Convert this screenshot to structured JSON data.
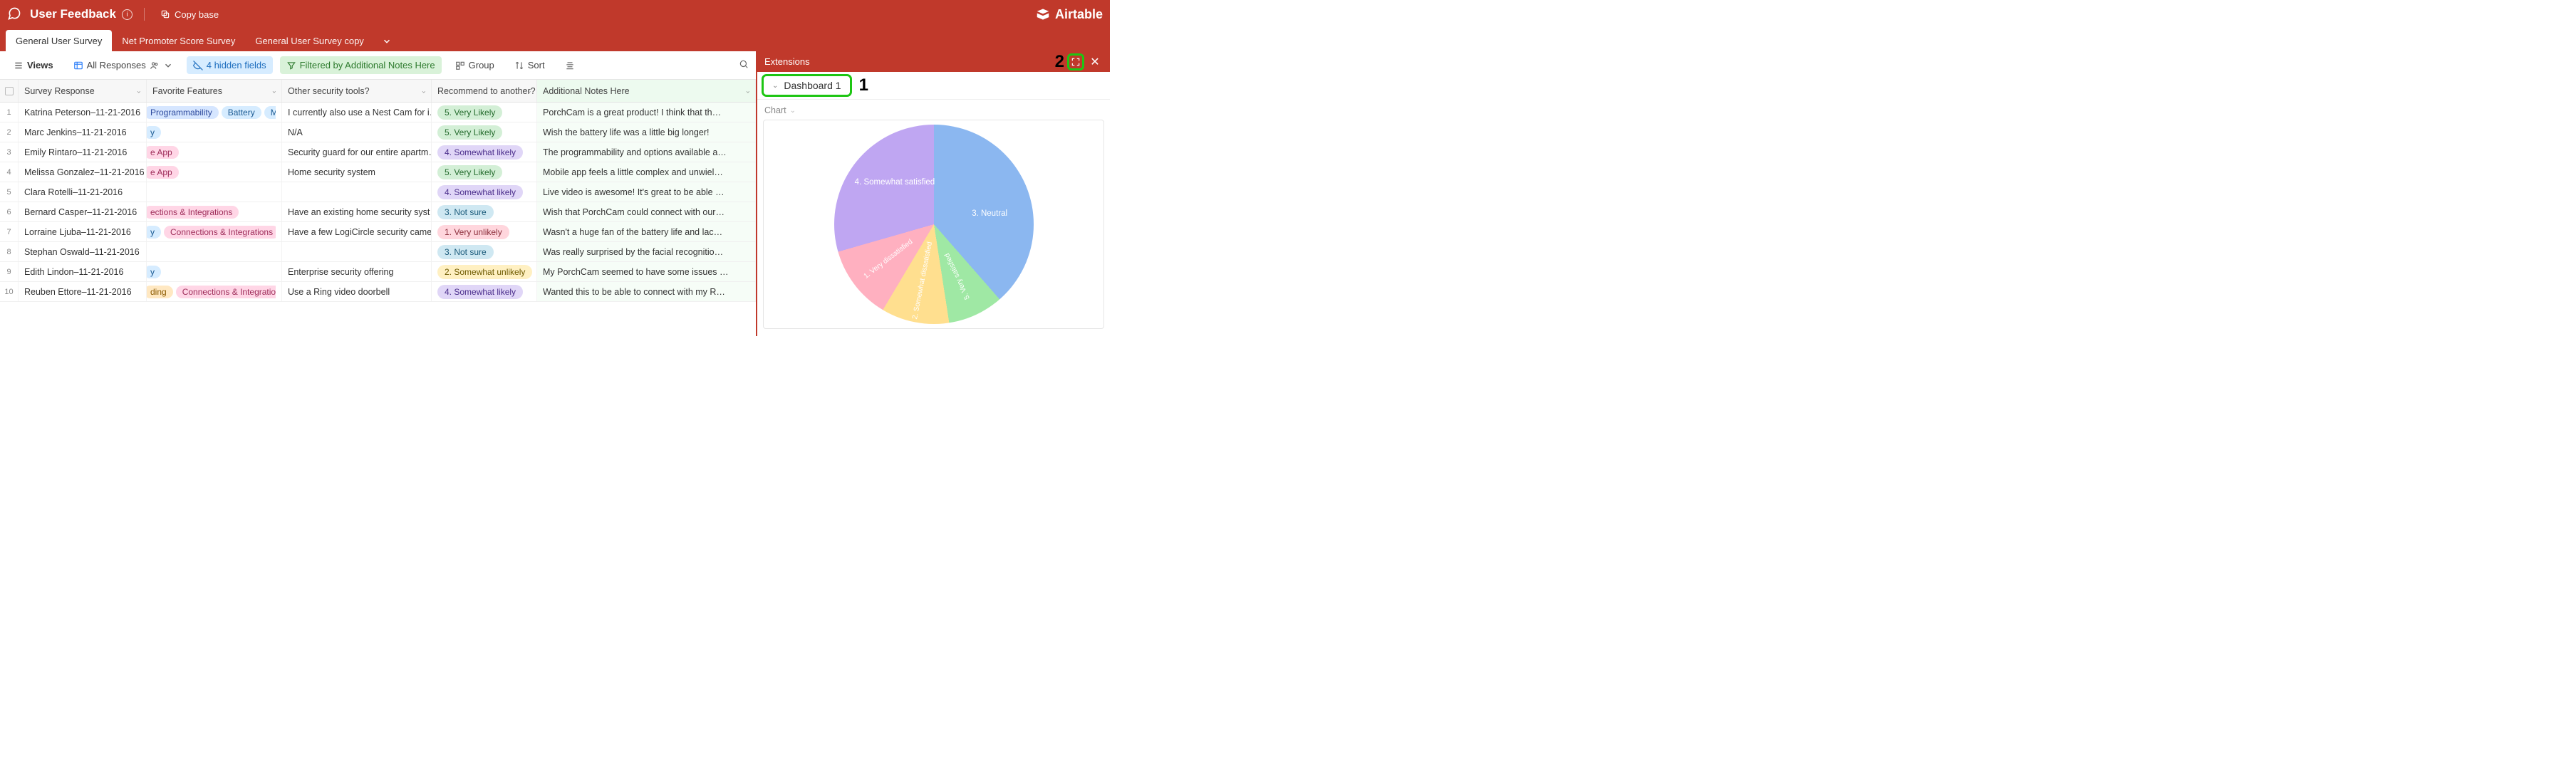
{
  "header": {
    "base_name": "User Feedback",
    "copy_label": "Copy base",
    "brand": "Airtable"
  },
  "tabs": [
    {
      "label": "General User Survey",
      "active": true
    },
    {
      "label": "Net Promoter Score Survey",
      "active": false
    },
    {
      "label": "General User Survey copy",
      "active": false
    }
  ],
  "ext_tab_label": "Extensions",
  "toolbar": {
    "views_label": "Views",
    "view_name": "All Responses",
    "hidden_fields": "4 hidden fields",
    "filter_label": "Filtered by Additional Notes Here",
    "group_label": "Group",
    "sort_label": "Sort"
  },
  "columns": {
    "survey_response": "Survey Response",
    "favorite_features": "Favorite Features",
    "other_security": "Other security tools?",
    "recommend": "Recommend to another?",
    "additional_notes": "Additional Notes Here"
  },
  "likert": {
    "r1": "1. Very unlikely",
    "r2": "2. Somewhat unlikely",
    "r3": "3. Not sure",
    "r4": "4. Somewhat likely",
    "r5": "5. Very Likely"
  },
  "feature_tags": {
    "programmability": "Programmability",
    "battery": "Battery",
    "mobile_app": "Mobile app",
    "y_partial": "y",
    "e_app_partial": "e App",
    "ections_partial": "ections & Integrations",
    "connections": "Connections & Integrations",
    "ding_partial": "ding"
  },
  "rows": [
    {
      "idx": "1",
      "sr": "Katrina Peterson–11-21-2016",
      "ff": [
        {
          "t": "prog",
          "k": "programmability"
        },
        {
          "t": "blue",
          "k": "battery"
        },
        {
          "t": "blue",
          "k": "mobile_app"
        }
      ],
      "ost": "I currently also use a Nest Cam for i…",
      "rec": "r5",
      "an": "PorchCam is a great product! I think that th…"
    },
    {
      "idx": "2",
      "sr": "Marc Jenkins–11-21-2016",
      "ff": [
        {
          "t": "blue",
          "k": "y_partial"
        }
      ],
      "ost": "N/A",
      "rec": "r5",
      "an": "Wish the battery life was a little big longer!"
    },
    {
      "idx": "3",
      "sr": "Emily Rintaro–11-21-2016",
      "ff": [
        {
          "t": "pink",
          "k": "e_app_partial"
        }
      ],
      "ost": "Security guard for our entire apartm…",
      "rec": "r4",
      "an": "The programmability and options available a…"
    },
    {
      "idx": "4",
      "sr": "Melissa Gonzalez–11-21-2016",
      "ff": [
        {
          "t": "pink",
          "k": "e_app_partial"
        }
      ],
      "ost": "Home security system",
      "rec": "r5",
      "an": "Mobile app feels a little complex and unwiel…"
    },
    {
      "idx": "5",
      "sr": "Clara Rotelli–11-21-2016",
      "ff": [],
      "ost": "",
      "rec": "r4",
      "an": "Live video is awesome! It's great to be able …"
    },
    {
      "idx": "6",
      "sr": "Bernard Casper–11-21-2016",
      "ff": [
        {
          "t": "pink",
          "k": "ections_partial"
        }
      ],
      "ost": "Have an existing home security syst…",
      "rec": "r3",
      "an": "Wish that PorchCam could connect with our…"
    },
    {
      "idx": "7",
      "sr": "Lorraine Ljuba–11-21-2016",
      "ff": [
        {
          "t": "blue",
          "k": "y_partial"
        },
        {
          "t": "pink",
          "k": "connections"
        }
      ],
      "ost": "Have a few LogiCircle security came…",
      "rec": "r1",
      "an": "Wasn't a huge fan of the battery life and lac…"
    },
    {
      "idx": "8",
      "sr": "Stephan Oswald–11-21-2016",
      "ff": [],
      "ost": "",
      "rec": "r3",
      "an": "Was really surprised by the facial recognitio…"
    },
    {
      "idx": "9",
      "sr": "Edith Lindon–11-21-2016",
      "ff": [
        {
          "t": "blue",
          "k": "y_partial"
        }
      ],
      "ost": "Enterprise security offering",
      "rec": "r2",
      "an": "My PorchCam seemed to have some issues …"
    },
    {
      "idx": "10",
      "sr": "Reuben Ettore–11-21-2016",
      "ff": [
        {
          "t": "orange",
          "k": "ding_partial"
        },
        {
          "t": "pink",
          "k": "connections"
        }
      ],
      "ost": "Use a Ring video doorbell",
      "rec": "r4",
      "an": "Wanted this to be able to connect with my R…"
    }
  ],
  "extensions": {
    "dashboard_name": "Dashboard 1",
    "chart_block_label": "Chart",
    "annotation_1": "1",
    "annotation_2": "2"
  },
  "chart_data": {
    "type": "pie",
    "title": "",
    "slices": [
      {
        "label": "3. Neutral",
        "value": 33,
        "color": "#8bb7f0"
      },
      {
        "label": "5. Very satisfied",
        "value": 9,
        "color": "#9fe8a4"
      },
      {
        "label": "2. Somewhat dissatisfied",
        "value": 11,
        "color": "#ffdf8f"
      },
      {
        "label": "1. Very dissatisfied",
        "value": 12,
        "color": "#ffb0c0"
      },
      {
        "label": "4. Somewhat satisfied",
        "value": 35,
        "color": "#bfa6f2"
      }
    ]
  }
}
